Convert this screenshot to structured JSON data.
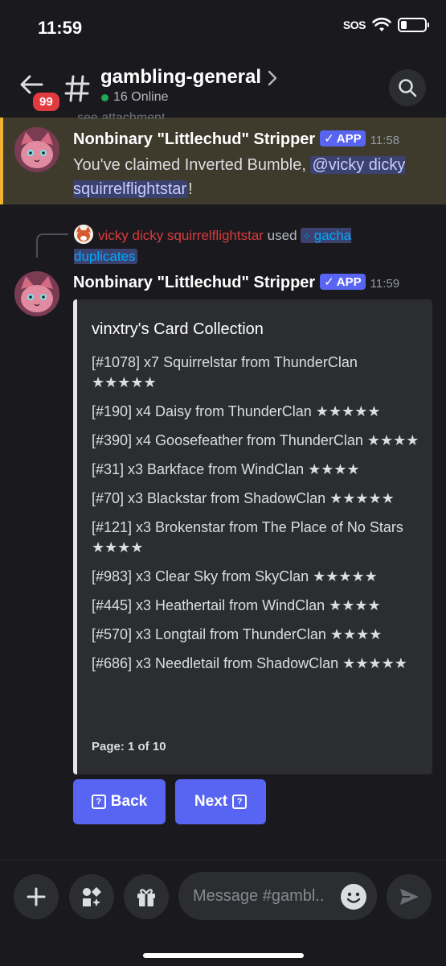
{
  "status": {
    "time": "11:59",
    "sos": "SOS"
  },
  "header": {
    "unread_count": "99",
    "channel_name": "gambling-general",
    "online": "16 Online"
  },
  "messages": [
    {
      "cut_text": "see attachment",
      "author": "Nonbinary \"Littlechud\" Stripper",
      "tag": "APP",
      "time": "11:58",
      "text_before": "You've claimed Inverted Bumble, ",
      "mention": "@vicky dicky squirrelflightstar",
      "text_after": "!"
    },
    {
      "reply_user": "vicky dicky squirrelflightstar",
      "reply_used": " used ",
      "reply_command": "gacha duplicates",
      "author": "Nonbinary \"Littlechud\" Stripper",
      "tag": "APP",
      "time": "11:59"
    }
  ],
  "embed": {
    "title": "vinxtry's Card Collection",
    "lines": [
      "[#1078] x7 Squirrelstar from ThunderClan ★★★★★",
      "[#190] x4 Daisy from ThunderClan ★★★★★",
      "[#390] x4 Goosefeather from ThunderClan ★★★★",
      "[#31] x3 Barkface from WindClan ★★★★",
      "[#70] x3 Blackstar from ShadowClan ★★★★★",
      "[#121] x3 Brokenstar from The Place of No Stars ★★★★",
      "[#983] x3 Clear Sky from SkyClan ★★★★★",
      "[#445] x3 Heathertail from WindClan ★★★★",
      "[#570] x3 Longtail from ThunderClan ★★★★",
      "[#686] x3 Needletail from ShadowClan ★★★★★"
    ],
    "footer": "Page: 1 of 10"
  },
  "buttons": {
    "back": "Back",
    "next": "Next",
    "icon_glyph": "?"
  },
  "composer": {
    "placeholder": "Message #gambl.."
  },
  "icons": [
    "back-arrow-icon",
    "hash-icon",
    "search-icon",
    "plus-icon",
    "apps-icon",
    "gift-icon",
    "emoji-icon",
    "send-icon"
  ],
  "colors": {
    "accent": "#5865f2",
    "mention_bg": "#3c4270",
    "highlight_bar": "#f0b232",
    "online": "#23a55a",
    "badge": "#e23b3f"
  }
}
